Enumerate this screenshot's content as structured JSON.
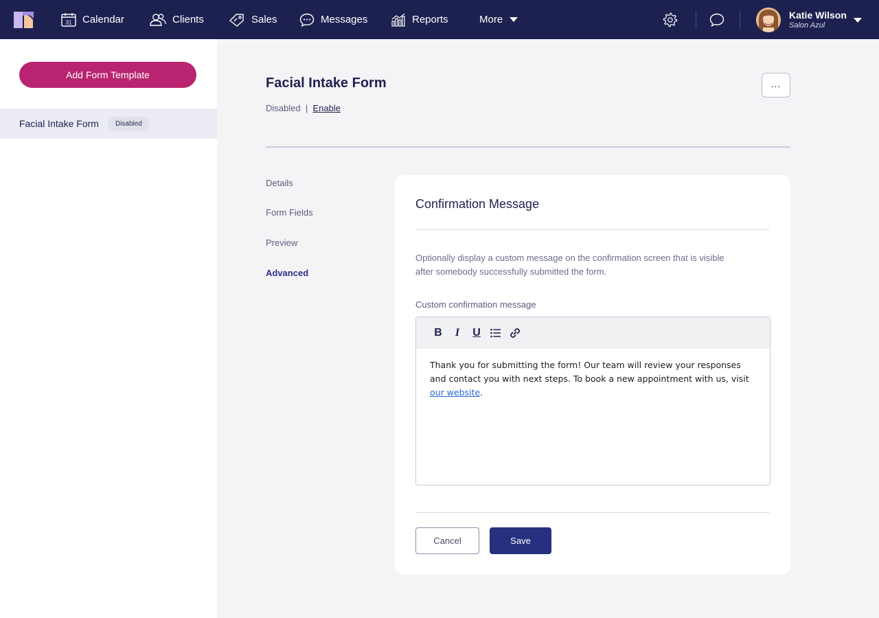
{
  "nav": {
    "items": [
      {
        "label": "Calendar",
        "icon": "calendar-icon"
      },
      {
        "label": "Clients",
        "icon": "clients-icon"
      },
      {
        "label": "Sales",
        "icon": "tag-icon"
      },
      {
        "label": "Messages",
        "icon": "chat-bubble-icon"
      },
      {
        "label": "Reports",
        "icon": "bar-chart-icon"
      },
      {
        "label": "More",
        "icon": "caret-down-icon"
      }
    ],
    "calendar_day": "31",
    "user": {
      "name": "Katie Wilson",
      "salon": "Salon Azul"
    }
  },
  "sidebar": {
    "add_button": "Add Form Template",
    "items": [
      {
        "label": "Facial Intake Form",
        "badge": "Disabled"
      }
    ]
  },
  "form": {
    "title": "Facial Intake Form",
    "status": "Disabled",
    "separator": "|",
    "enable_link": "Enable",
    "more_label": "..."
  },
  "subnav": {
    "items": [
      "Details",
      "Form Fields",
      "Preview",
      "Advanced"
    ],
    "active": "Advanced"
  },
  "card": {
    "title": "Confirmation Message",
    "description": "Optionally display a custom message on the confirmation screen that is visible after somebody successfully submitted the form.",
    "field_label": "Custom confirmation message",
    "toolbar": {
      "bold": "B",
      "italic": "I",
      "underline": "U"
    },
    "message_text": "Thank you for submitting the form! Our team will review your responses and contact you with next steps. To book a new appointment with us, visit ",
    "message_link": "our website",
    "message_end": ".",
    "cancel_label": "Cancel",
    "save_label": "Save"
  },
  "colors": {
    "nav_bg": "#1d2150",
    "accent": "#b8246f",
    "primary": "#27307f"
  }
}
